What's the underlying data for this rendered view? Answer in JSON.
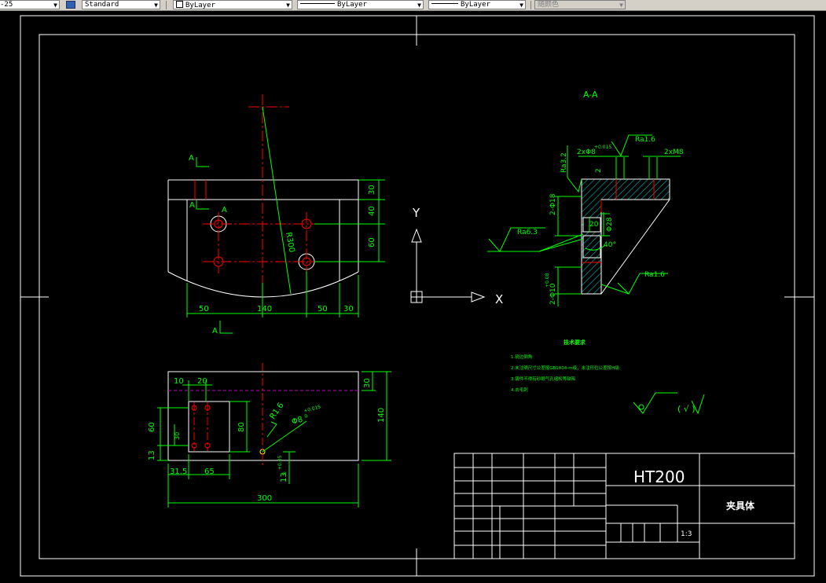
{
  "toolbar": {
    "dimstyle": "-25",
    "textstyle": "Standard",
    "layer": "ByLayer",
    "linetype": "ByLayer",
    "lineweight": "ByLayer",
    "plotstyle": "随颜色"
  },
  "drawing": {
    "section_label": "A-A",
    "view_label_a": "A",
    "ucs_x": "X",
    "ucs_y": "Y",
    "dims_front": [
      "30",
      "40",
      "60",
      "50",
      "140",
      "50",
      "30",
      "R300"
    ],
    "dims_top": [
      "10",
      "20",
      "30",
      "140",
      "60",
      "30",
      "13",
      "80",
      "31.5",
      "65",
      "300",
      "13",
      "R1.6",
      "Φ8"
    ],
    "dims_top_tol": [
      "+0.015",
      "0",
      "+0.05",
      "0"
    ],
    "dims_section": [
      "2xΦ8",
      "+0.015",
      "Ra1.6",
      "2xM8",
      "Ra3.2",
      "2",
      "2-Φ18",
      "Φ28",
      "20",
      "Ra6.3",
      "40°",
      "2-Φ10",
      "+0.08",
      "Ra1.6"
    ],
    "notes_title": "技术要求",
    "notes": [
      "1.锐边倒角",
      "2.未注明尺寸公差按GB1804-m级，未注形位公差按H级",
      "3.铸件不得有砂眼气孔缩松等缺陷",
      "4.去毛刺"
    ],
    "roughness_general": "( √ )",
    "material": "HT200",
    "part_name": "夹具体",
    "scale": "1:3"
  },
  "colors": {
    "background": "#000000",
    "geometry": "#ffffff",
    "dimension": "#00ff00",
    "centerline": "#ff0000",
    "hatch": "#00c0c0",
    "hidden": "#c000c0"
  }
}
